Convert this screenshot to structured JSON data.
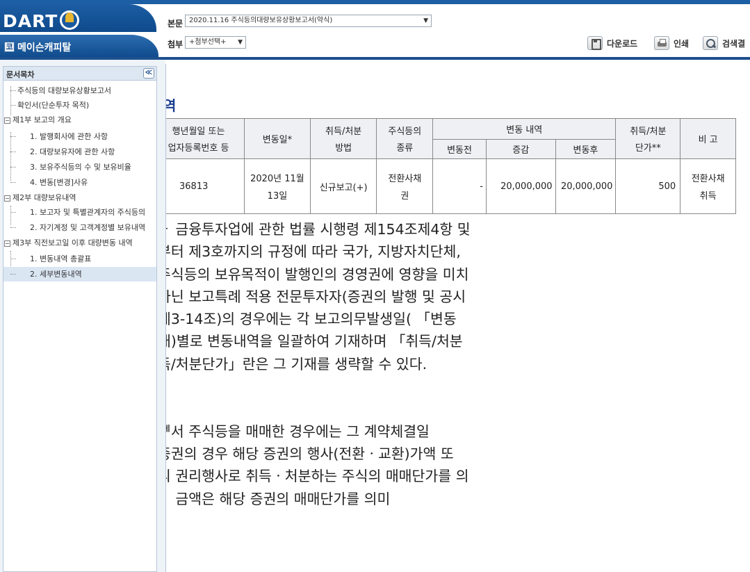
{
  "header": {
    "logo": "DART",
    "company_name": "메이슨캐피탈",
    "company_icon": "코",
    "main_doc_label": "본문",
    "main_doc_value": "2020.11.16  주식등의대량보유상황보고서(약식)",
    "attach_label": "첨부",
    "attach_value": "+첨부선택+",
    "download_label": "다운로드",
    "print_label": "인쇄",
    "search_label": "검색결"
  },
  "toc": {
    "title": "문서목차",
    "collapse": "≪",
    "items": [
      {
        "label": "주식등의 대량보유상황보고서"
      },
      {
        "label": "확인서(단순투자 목적)"
      },
      {
        "label": "제1부 보고의 개요"
      },
      {
        "label": "1. 발행회사에 관한 사항"
      },
      {
        "label": "2. 대량보유자에 관한 사항"
      },
      {
        "label": "3. 보유주식등의 수 및 보유비율"
      },
      {
        "label": "4. 변동[변경]사유"
      },
      {
        "label": "제2부 대량보유내역"
      },
      {
        "label": "1. 보고자 및 특별관계자의 주식등의"
      },
      {
        "label": "2. 자기계정 및 고객계정별 보유내역"
      },
      {
        "label": "제3부 직전보고일 이후 대량변동 내역"
      },
      {
        "label": "1. 변동내역 총괄표"
      },
      {
        "label": "2. 세부변동내역"
      }
    ]
  },
  "content": {
    "heading": "역",
    "table": {
      "headers": {
        "col1_line1": "행년월일 또는",
        "col1_line2": "업자등록번호 등",
        "change_date": "변동일*",
        "method_line1": "취득/처분",
        "method_line2": "방법",
        "type_line1": "주식등의",
        "type_line2": "종류",
        "change_detail": "변동 내역",
        "before": "변동전",
        "delta": "증감",
        "after": "변동후",
        "price_line1": "취득/처분",
        "price_line2": "단가**",
        "remarks": "비 고"
      },
      "row": {
        "id": "36813",
        "date_line1": "2020년 11월",
        "date_line2": "13일",
        "method": "신규보고(+)",
        "type_line1": "전환사채",
        "type_line2": "권",
        "before": "-",
        "delta": "20,000,000",
        "after": "20,000,000",
        "price": "500",
        "remarks_line1": "전환사채",
        "remarks_line2": "취득"
      }
    },
    "notes": [
      "ㅏ 금융투자업에 관한 법률 시행령 제154조제4항 및",
      "부터 제3호까지의 규정에 따라 국가, 지방자치단체,",
      "주식등의 보유목적이 발행인의 경영권에 영향을 미치",
      "아닌 보고특례 적용 전문투자자(증권의 발행 및 공시",
      " 제3-14조)의 경우에는 각 보고의무발생일( 「변동",
      "재)별로 변동내역을 일괄하여 기재하며 「취득/처분",
      "득/처분단가」란은 그 기재를 생략할 수 있다.",
      "",
      "",
      "ᅦ서 주식등을 매매한 경우에는 그 계약체결일",
      " 증권의 경우 해당 증권의 행사(전환ㆍ교환)가액 또",
      "의 권리행사로 취득ㆍ처분하는 주식의 매매단가를 의",
      "ㅣ 금액은 해당 증권의 매매단가를 의미"
    ]
  }
}
